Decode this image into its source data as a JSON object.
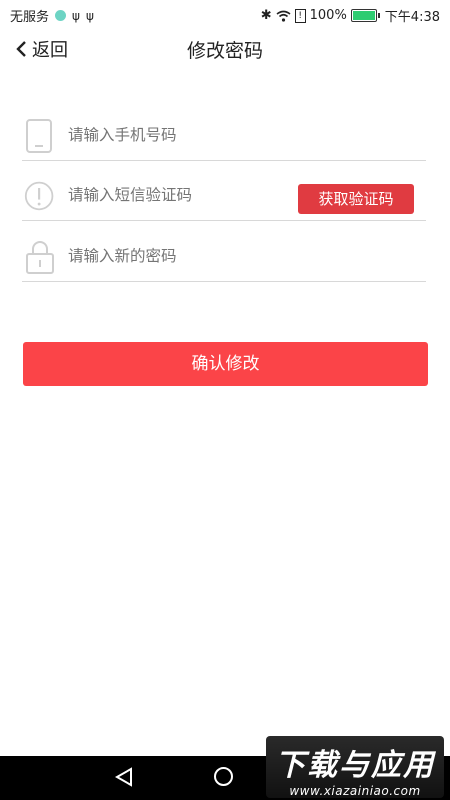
{
  "status_bar": {
    "carrier": "无服务",
    "battery_percent": "100%",
    "time": "下午4:38",
    "battery_level": 1.0,
    "icons": [
      "app-dot-icon",
      "usb-icon",
      "usb-icon",
      "bluetooth-icon",
      "wifi-icon",
      "alert-icon",
      "battery-icon"
    ]
  },
  "header": {
    "back_label": "返回",
    "title": "修改密码"
  },
  "form": {
    "phone_placeholder": "请输入手机号码",
    "code_placeholder": "请输入短信验证码",
    "get_code_label": "获取验证码",
    "password_placeholder": "请输入新的密码",
    "confirm_label": "确认修改"
  },
  "nav": {
    "icons": [
      "back-triangle-icon",
      "home-circle-icon"
    ]
  },
  "watermark": {
    "main": "下载与应用",
    "sub": "www.xiazainiao.com"
  },
  "colors": {
    "accent": "#fb4448",
    "code_button": "#e03b41",
    "placeholder": "#b8b8b8",
    "divider": "#d8d8d8"
  }
}
